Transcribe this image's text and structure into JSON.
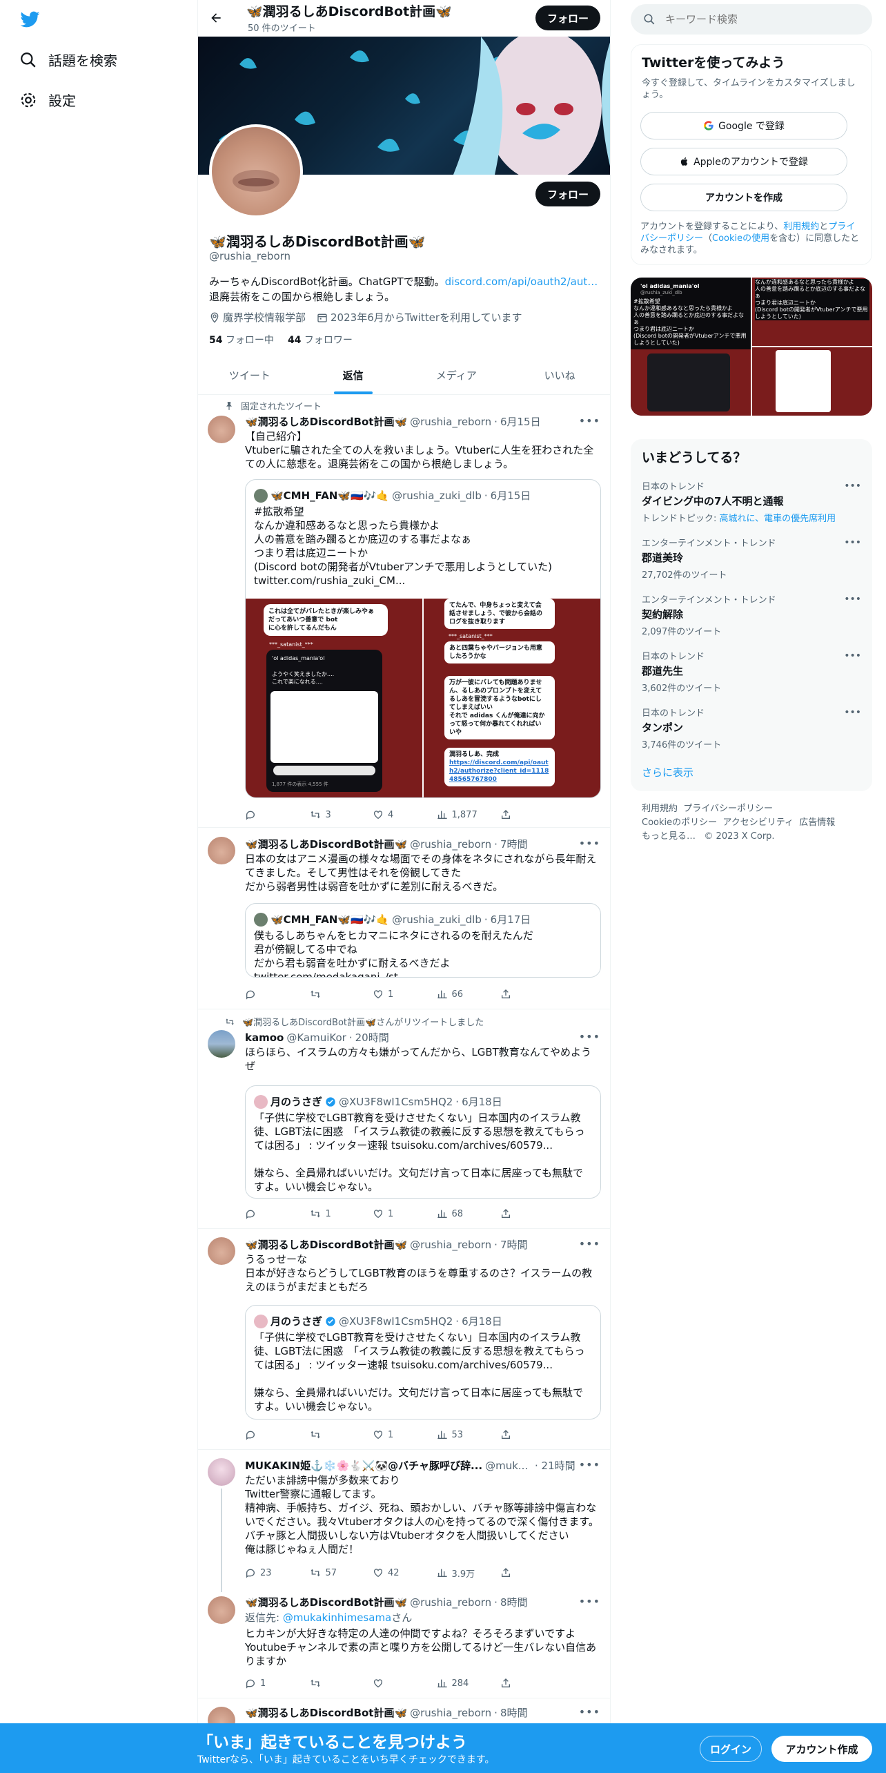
{
  "nav": {
    "explore_label": "話題を検索",
    "settings_label": "設定"
  },
  "header": {
    "name": "🦋潤羽るしあDiscordBot計画🦋",
    "tweet_count": "50 件のツイート",
    "follow_label": "フォロー"
  },
  "profile": {
    "name": "🦋潤羽るしあDiscordBot計画🦋",
    "handle": "@rushia_reborn",
    "bio_line1": "みーちゃんDiscordBot化計画。ChatGPTで駆動。",
    "bio_link": "discord.com/api/oauth2/aut…",
    "bio_line2": "退廃芸術をこの国から根絶しましょう。",
    "location": "魔界学校情報学部",
    "joined": "2023年6月からTwitterを利用しています",
    "following_count": "54",
    "following_label": "フォロー中",
    "followers_count": "44",
    "followers_label": "フォロワー",
    "follow_label": "フォロー"
  },
  "tabs": [
    "ツイート",
    "返信",
    "メディア",
    "いいね"
  ],
  "tweets": [
    {
      "pinned_label": "固定されたツイート",
      "name": "🦋潤羽るしあDiscordBot計画🦋",
      "handle": "@rushia_reborn",
      "time": "6月15日",
      "text": "【自己紹介】\nVtuberに騙された全ての人を救いましょう。Vtuberに人生を狂わされた全ての人に慈悲を。退廃芸術をこの国から根絶しましょう。",
      "quote": {
        "name": "🦋CMH_FAN🦋🇷🇺🎶🤙",
        "handle": "@rushia_zuki_dlb",
        "time": "6月15日",
        "text": "#拡散希望\nなんか違和感あるなと思ったら貴様かよ\n人の善意を踏み躙るとか底辺のする事だよなぁ\nつまり君は底辺ニートか\n(Discord botの開発者がVtuberアンチで悪用しようとしていた)\ntwitter.com/rushia_zuki_CM..."
      },
      "media_left": {
        "bubble1": "これは全てがバレたときが楽しみやぁ\nだってあいつ善意で bot\nに心を許してるんだもん",
        "user1": "***_satanist_***",
        "user2": "***_satanist_***",
        "q_name": "'ol adidas_mania'ol",
        "q_text": "ようやく笑えましたか....\nこれで楽になれる....",
        "stats": "1,877 件の表示  4,555 件"
      },
      "media_right": {
        "b1": "てたんで、中身ちょっと変えて会\n話させましょう、で彼から会話の\nログを抜き取ります",
        "b2": "あと四葉ちゃやバージョンも用意\nしたろうかな",
        "b3": "万が一彼にバレても問題ありませ\nん、るしあのプロンプトを変えて\nるしあを冒涜するようなbotにし\nてしまえばいい\nそれで adidas くんが俺達に向か\nって怒って何か暴れてくれればい\nいや",
        "b4": "潤羽るしあ、完成",
        "b4_link": "https://discord.com/api/oauth2/authorize?client_id=111848565767800",
        "user": "***_satanist_***"
      },
      "replies": "",
      "retweets": "3",
      "likes": "4",
      "views": "1,877"
    },
    {
      "name": "🦋潤羽るしあDiscordBot計画🦋",
      "handle": "@rushia_reborn",
      "time": "7時間",
      "text": "日本の女はアニメ漫画の様々な場面でその身体をネタにされながら長年耐えてきました。そして男性はそれを傍観してきた\nだから弱者男性は弱音を吐かずに差別に耐えるべきだ。",
      "quote": {
        "name": "🦋CMH_FAN🦋🇷🇺🎶🤙",
        "handle": "@rushia_zuki_dlb",
        "time": "6月17日",
        "text": "僕もるしあちゃんをヒカマニにネタにされるのを耐えたんだ\n君が傍観してる中でね\nだから君も弱音を吐かずに耐えるべきだよ twitter.com/medakagani_/st..."
      },
      "replies": "",
      "retweets": "",
      "likes": "1",
      "views": "66"
    },
    {
      "retweet_label": "🦋潤羽るしあDiscordBot計画🦋さんがリツイートしました",
      "name": "kamoo",
      "handle": "@KamuiKor",
      "time": "20時間",
      "text": "ほらほら、イスラムの方々も嫌がってんだから、LGBT教育なんてやめようぜ",
      "quote": {
        "name": "月のうさぎ",
        "handle": "@XU3F8wI1Csm5HQ2",
        "time": "6月18日",
        "text": "「子供に学校でLGBT教育を受けさせたくない」日本国内のイスラム教徒、LGBT法に困惑　「イスラム教徒の教義に反する思想を教えてもらっては困る」 : ツイッター速報 tsuisoku.com/archives/60579...\n\n嫌なら、全員帰ればいいだけ。文句だけ言って日本に居座っても無駄ですよ。いい機会じゃない。"
      },
      "replies": "",
      "retweets": "1",
      "likes": "1",
      "views": "68"
    },
    {
      "name": "🦋潤羽るしあDiscordBot計画🦋",
      "handle": "@rushia_reborn",
      "time": "7時間",
      "text": "うるっせーな\n日本が好きならどうしてLGBT教育のほうを尊重するのさ？イスラームの教えのほうがまだまともだろ",
      "quote": {
        "name": "月のうさぎ",
        "handle": "@XU3F8wI1Csm5HQ2",
        "time": "6月18日",
        "text": "「子供に学校でLGBT教育を受けさせたくない」日本国内のイスラム教徒、LGBT法に困惑　「イスラム教徒の教義に反する思想を教えてもらっては困る」 : ツイッター速報 tsuisoku.com/archives/60579...\n\n嫌なら、全員帰ればいいだけ。文句だけ言って日本に居座っても無駄ですよ。いい機会じゃない。"
      },
      "replies": "",
      "retweets": "",
      "likes": "1",
      "views": "53"
    },
    {
      "name": "MUKAKIN姫⚓️❄️🌸🐇⚔️🐼@バチャ豚呼び辞...",
      "handle": "@muk...",
      "time": "21時間",
      "text": "ただいま誹謗中傷が多数来ており\nTwitter警察に通報してます。\n精神病、手帳持ち、ガイジ、死ね、頭おかしい、バチャ豚等誹謗中傷言わないでください。我々Vtuberオタクは人の心を持ってるので深く傷付きます。\nバチャ豚と人間扱いしない方はVtuberオタクを人間扱いしてください\n俺は豚じゃねぇ人間だ！",
      "replies": "23",
      "retweets": "57",
      "likes": "42",
      "views": "3.9万"
    },
    {
      "name": "🦋潤羽るしあDiscordBot計画🦋",
      "handle": "@rushia_reborn",
      "time": "8時間",
      "reply_to_label": "返信先: ",
      "reply_to": "@mukakinhimesama",
      "reply_to_suffix": "さん",
      "text": "ヒカキンが大好きな特定の人達の仲間ですよね？そろそろまずいですよ\nYoutubeチャンネルで素の声と喋り方を公開してるけど一生バレない自信ありますか",
      "replies": "1",
      "retweets": "",
      "likes": "",
      "views": "284"
    },
    {
      "name": "🦋潤羽るしあDiscordBot計画🦋",
      "handle": "@rushia_reborn",
      "time": "8時間"
    }
  ],
  "search": {
    "placeholder": "キーワード検索"
  },
  "signup": {
    "title": "Twitterを使ってみよう",
    "subtitle": "今すぐ登録して、タイムラインをカスタマイズしましょう。",
    "google_label": "Google で登録",
    "apple_label": "Appleのアカウントで登録",
    "create_label": "アカウントを作成",
    "legal1": "アカウントを登録することにより、",
    "terms": "利用規約",
    "and": "と",
    "privacy": "プライバシーポリシー",
    "cookie_pre": "（",
    "cookie": "Cookieの使用",
    "legal2": "を含む）に同意したとみなされます。"
  },
  "media_grid": {
    "t1_name": "'ol adidas_mania'ol",
    "t1_handle": "@rushia_zuki_dlb",
    "t1_text": "#拡散希望\nなんか違和感あるなと思ったら貴様かよ\n人の善意を踏み躙るとか底辺のする事だよなぁ\nつまり君は底辺ニートか\n(Discord botの開発者がVtuberアンチで悪用しようとしていた)",
    "t2_text": "なんか違和感あるなと思ったら貴様かよ\n人の善意を踏み躙るとか底辺のする事だよなぁ\nつまり君は底辺ニートか\n(Discord botの開発者がVtuberアンチで悪用しようとしていた)"
  },
  "trends": {
    "title": "いまどうしてる？",
    "items": [
      {
        "category": "日本のトレンド",
        "name": "ダイビング中の7人不明と通報",
        "topic_label": "トレンドトピック: ",
        "topic": "高城れに、電車の優先席利用",
        "count": ""
      },
      {
        "category": "エンターテインメント・トレンド",
        "name": "郡道美玲",
        "count": "27,702件のツイート"
      },
      {
        "category": "エンターテインメント・トレンド",
        "name": "契約解除",
        "count": "2,097件のツイート"
      },
      {
        "category": "日本のトレンド",
        "name": "郡道先生",
        "count": "3,602件のツイート"
      },
      {
        "category": "日本のトレンド",
        "name": "タンポン",
        "count": "3,746件のツイート"
      }
    ],
    "more_label": "さらに表示"
  },
  "footer": {
    "l1": "利用規約",
    "l2": "プライバシーポリシー",
    "l3": "Cookieのポリシー",
    "l4": "アクセシビリティ",
    "l5": "広告情報",
    "l6": "もっと見る…",
    "copyright": "© 2023 X Corp."
  },
  "bottom": {
    "title": "「いま」起きていることを見つけよう",
    "subtitle": "Twitterなら、「いま」起きていることをいち早くチェックできます。",
    "login_label": "ログイン",
    "signup_label": "アカウント作成"
  },
  "colors": {
    "accent": "#1d9bf0",
    "text": "#0f1419",
    "muted": "#536471",
    "border": "#eff3f4"
  }
}
